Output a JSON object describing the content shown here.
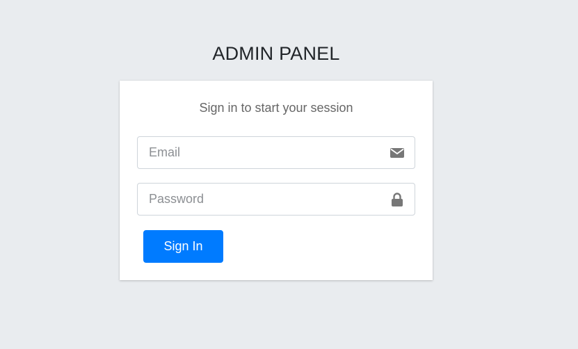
{
  "logo": {
    "text": "ADMIN PANEL"
  },
  "card": {
    "message": "Sign in to start your session"
  },
  "email": {
    "placeholder": "Email",
    "value": "",
    "icon": "envelope-icon"
  },
  "password": {
    "placeholder": "Password",
    "value": "",
    "icon": "lock-icon"
  },
  "submit": {
    "label": "Sign In"
  },
  "colors": {
    "background": "#e9ecef",
    "primary": "#007bff",
    "icon": "#777777"
  }
}
